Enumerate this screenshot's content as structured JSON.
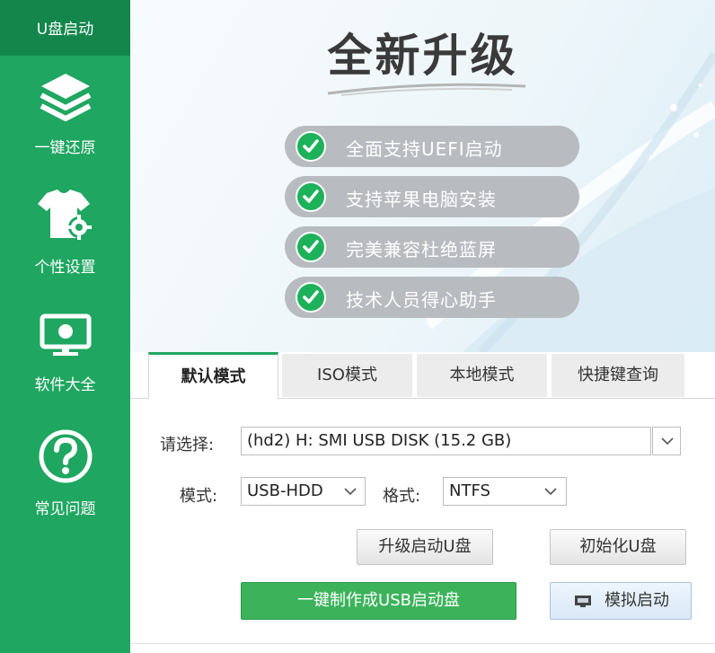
{
  "sidebar": {
    "items": [
      {
        "label": "U盘启动",
        "icon": "usb-boot-icon"
      },
      {
        "label": "一键还原",
        "icon": "layers-icon"
      },
      {
        "label": "个性设置",
        "icon": "shirt-gear-icon"
      },
      {
        "label": "软件大全",
        "icon": "monitor-icon"
      },
      {
        "label": "常见问题",
        "icon": "question-icon"
      }
    ],
    "active_index": 0
  },
  "banner": {
    "title": "全新升级",
    "features": [
      "全面支持UEFI启动",
      "支持苹果电脑安装",
      "完美兼容杜绝蓝屏",
      "技术人员得心助手"
    ]
  },
  "tabs": [
    {
      "label": "默认模式",
      "active": true
    },
    {
      "label": "ISO模式",
      "active": false
    },
    {
      "label": "本地模式",
      "active": false
    },
    {
      "label": "快捷键查询",
      "active": false
    }
  ],
  "form": {
    "select_label": "请选择:",
    "device_value": "(hd2) H: SMI USB DISK (15.2 GB)",
    "mode_label": "模式:",
    "mode_value": "USB-HDD",
    "format_label": "格式:",
    "format_value": "NTFS"
  },
  "buttons": {
    "upgrade": "升级启动U盘",
    "init": "初始化U盘",
    "make": "一键制作成USB启动盘",
    "simulate": "模拟启动"
  },
  "colors": {
    "sidebar": "#1fa660",
    "accent_green": "#3cb35b",
    "check_green": "#1db25a"
  }
}
